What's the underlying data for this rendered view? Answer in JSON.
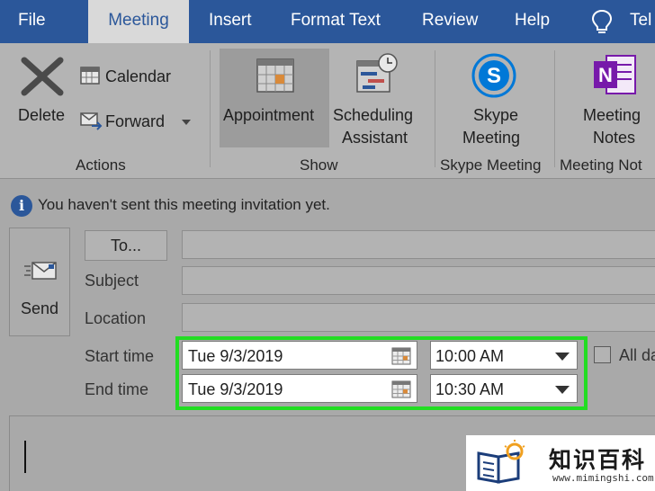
{
  "tabs": {
    "file": "File",
    "meeting": "Meeting",
    "insert": "Insert",
    "format_text": "Format Text",
    "review": "Review",
    "help": "Help",
    "tell_me": "Tel",
    "tell_me_icon": "lightbulb-icon"
  },
  "ribbon": {
    "delete_label": "Delete",
    "calendar_label": "Calendar",
    "forward_label": "Forward",
    "actions_group": "Actions",
    "appointment_label": "Appointment",
    "scheduling_line1": "Scheduling",
    "scheduling_line2": "Assistant",
    "show_group": "Show",
    "skype_line1": "Skype",
    "skype_line2": "Meeting",
    "skype_group": "Skype Meeting",
    "notes_line1": "Meeting",
    "notes_line2": "Notes",
    "notes_group": "Meeting Not",
    "skype_color": "#0078d7",
    "onenote_color": "#7719aa"
  },
  "info": {
    "message": "You haven't sent this meeting invitation yet."
  },
  "form": {
    "send_label": "Send",
    "to_label": "To...",
    "subject_label": "Subject",
    "location_label": "Location",
    "start_label": "Start time",
    "end_label": "End time",
    "start_date": "Tue 9/3/2019",
    "start_time": "10:00 AM",
    "end_date": "Tue 9/3/2019",
    "end_time": "10:30 AM",
    "all_day_label": "All da",
    "highlight_color": "#22dd22"
  },
  "watermark": {
    "title": "知识百科",
    "url": "www.mimingshi.com"
  }
}
